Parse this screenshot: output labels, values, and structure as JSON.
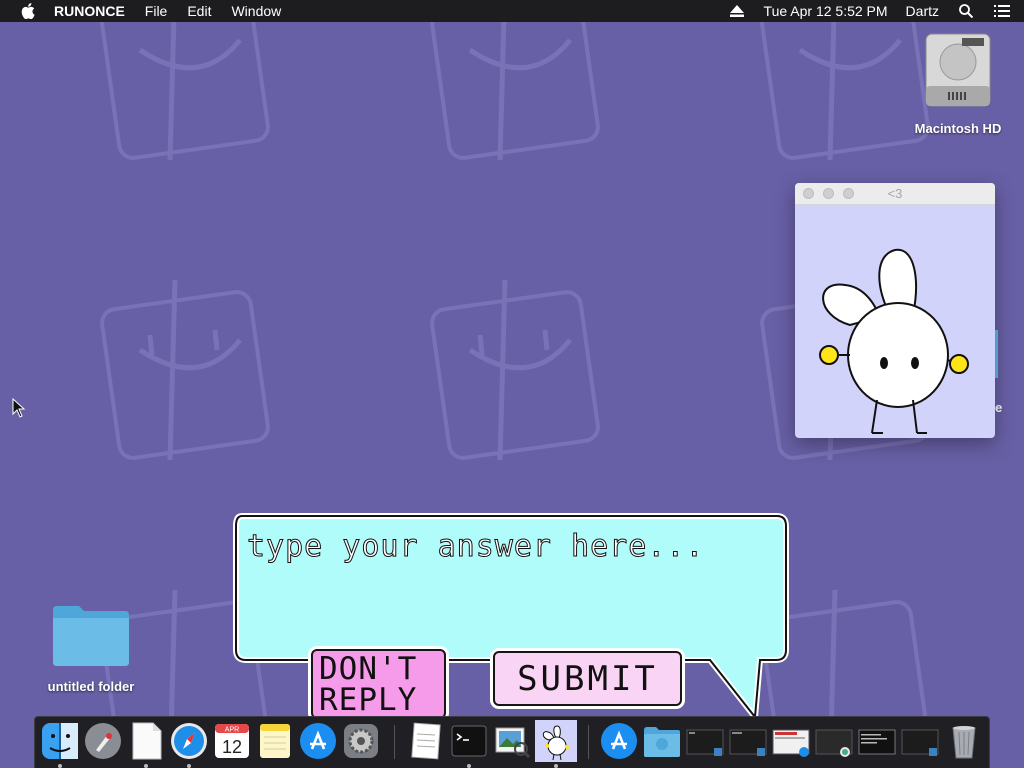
{
  "menubar": {
    "app_name": "RUNONCE",
    "menus": [
      "File",
      "Edit",
      "Window"
    ],
    "clock": "Tue Apr 12  5:52 PM",
    "user": "Dartz",
    "icons": [
      "apple-icon",
      "eject-icon",
      "spotlight-icon",
      "notification-center-icon"
    ]
  },
  "desktop": {
    "hd_label": "Macintosh HD",
    "folder_label": "untitled folder",
    "peek_text": "e"
  },
  "mini_window": {
    "title": "<3",
    "image": "bunny-character"
  },
  "answer_box": {
    "placeholder": "type your answer here...",
    "value": ""
  },
  "buttons": {
    "dont_reply": "DON'T REPLY",
    "submit": "SUBMIT"
  },
  "dock": {
    "calendar_month": "APR",
    "calendar_day": "12",
    "items": [
      "finder-icon",
      "launchpad-icon",
      "document-icon",
      "safari-icon",
      "calendar-icon",
      "notes-icon",
      "app-store-icon",
      "system-preferences-icon",
      "textedit-icon",
      "terminal-icon",
      "preview-icon",
      "bunny-app-icon",
      "app-store-download-icon",
      "folder-icon",
      "window-thumbnail",
      "window-thumbnail",
      "window-thumbnail",
      "window-thumbnail",
      "window-thumbnail",
      "window-thumbnail",
      "trash-icon"
    ]
  },
  "colors": {
    "desktop": "#6860a6",
    "bubble": "#b0fcfb",
    "dont_reply_button": "#f59bea",
    "submit_button": "#f9d4f5",
    "mini_window_bg": "#d2d3fb"
  }
}
